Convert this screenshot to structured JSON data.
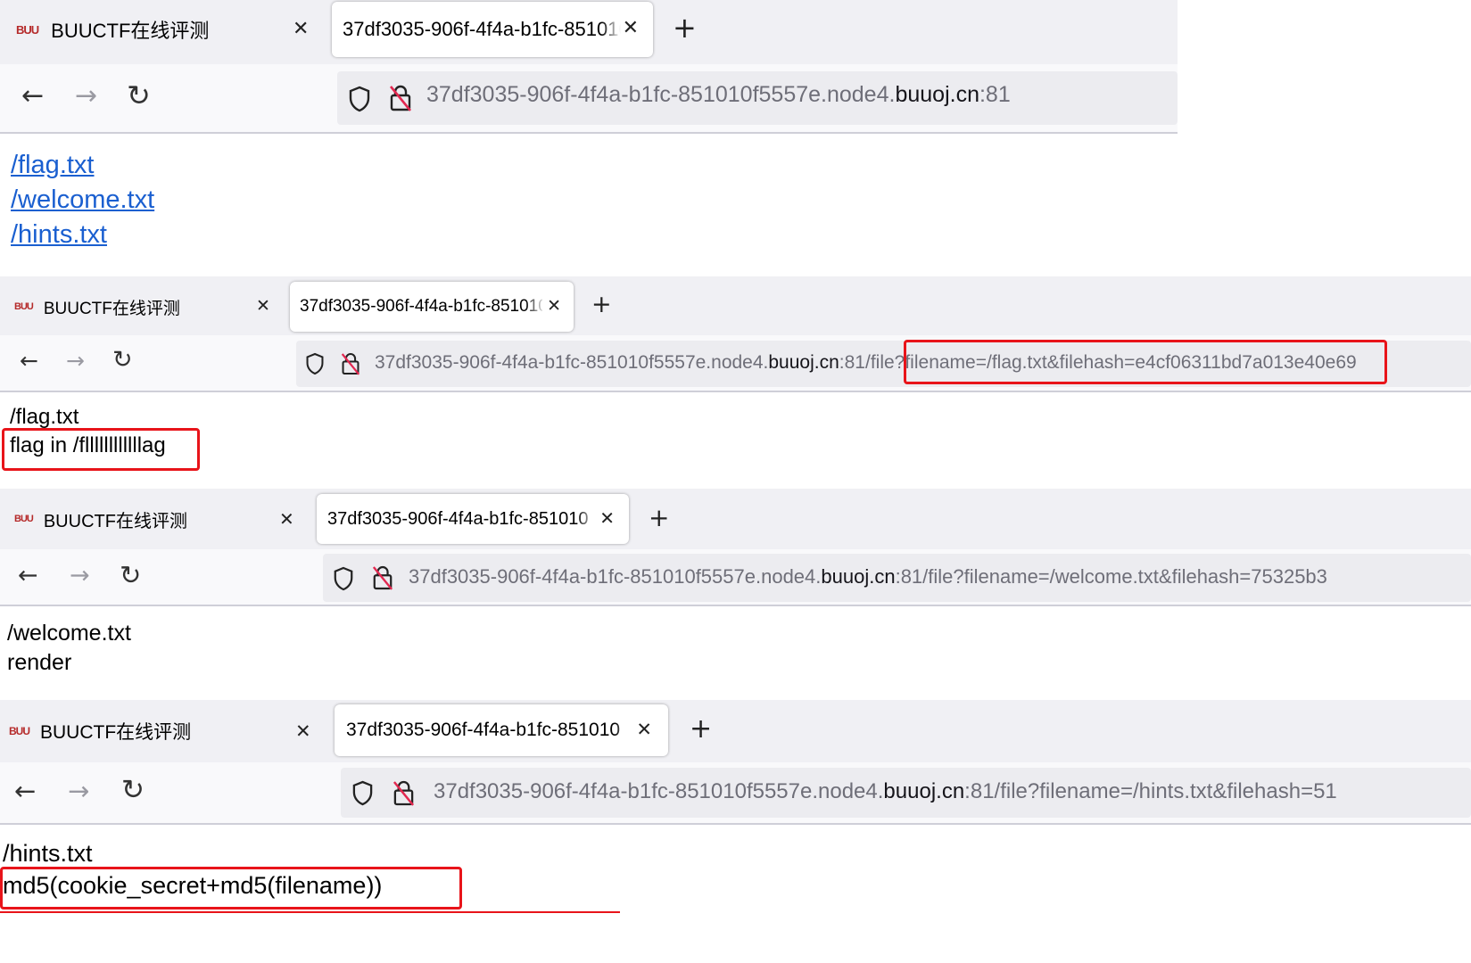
{
  "tabs": {
    "inactive_title": "BUUCTF在线评测",
    "favicon_text": "BUU",
    "close_glyph": "✕",
    "active_title": "37df3035-906f-4f4a-b1fc-851010",
    "new_tab_glyph": "+"
  },
  "nav": {
    "back": "←",
    "forward": "→",
    "reload": "↻"
  },
  "url_parts": {
    "subdomain": "37df3035-906f-4f4a-b1fc-851010f5557e.node4.",
    "domain": "buuoj.cn",
    "port": ":81"
  },
  "panel1": {
    "path": "",
    "links": [
      "/flag.txt",
      "/welcome.txt",
      "/hints.txt"
    ]
  },
  "panel2": {
    "path": "/file?filename=/flag.txt&filehash=e4cf06311bd7a013e40e69",
    "lines": [
      "/flag.txt",
      "flag in /fllllllllllllag"
    ]
  },
  "panel3": {
    "path": "/file?filename=/welcome.txt&filehash=75325b3",
    "lines": [
      "/welcome.txt",
      "render"
    ]
  },
  "panel4": {
    "path": "/file?filename=/hints.txt&filehash=51",
    "lines": [
      "/hints.txt",
      "md5(cookie_secret+md5(filename))"
    ]
  },
  "colors": {
    "highlight": "#e8141a",
    "link": "#1a5fd0",
    "tabbar_bg": "#f0f0f4",
    "favicon": "#b52a2a"
  }
}
